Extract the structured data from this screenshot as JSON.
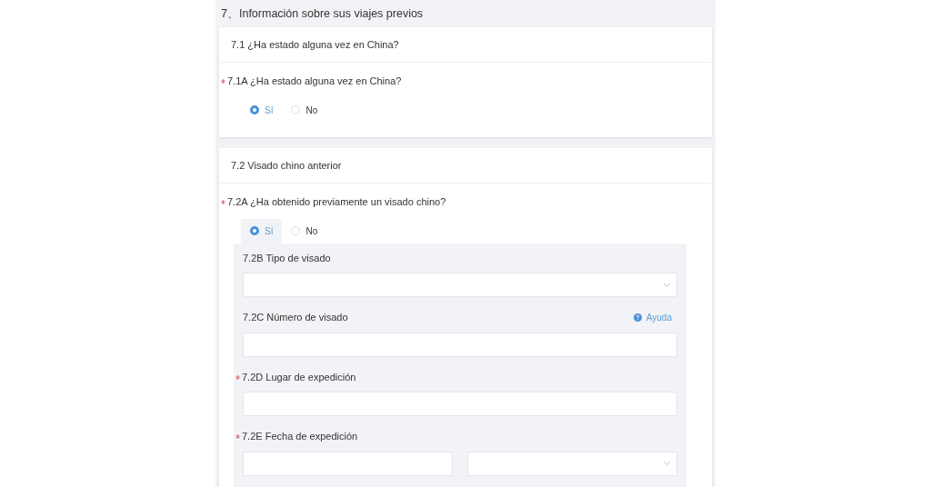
{
  "section_title": "7、Información sobre sus viajes previos",
  "cards": [
    {
      "title": "7.1 ¿Ha estado alguna vez en China?",
      "question": {
        "label": "7.1A ¿Ha estado alguna vez en China?",
        "required": true,
        "options": [
          {
            "label": "Sí",
            "selected": true
          },
          {
            "label": "No",
            "selected": false
          }
        ]
      }
    },
    {
      "title": "7.2 Visado chino anterior",
      "question": {
        "label": "7.2A ¿Ha obtenido previamente un visado chino?",
        "required": true,
        "options": [
          {
            "label": "Sí",
            "selected": true
          },
          {
            "label": "No",
            "selected": false
          }
        ]
      },
      "details": [
        {
          "kind": "select",
          "label": "7.2B Tipo de visado",
          "required": false
        },
        {
          "kind": "text",
          "label": "7.2C Número de visado",
          "required": false,
          "help": "Ayuda"
        },
        {
          "kind": "text",
          "label": "7.2D Lugar de expedición",
          "required": true
        },
        {
          "kind": "date",
          "label": "7.2E Fecha de expedición",
          "required": true
        }
      ]
    }
  ]
}
